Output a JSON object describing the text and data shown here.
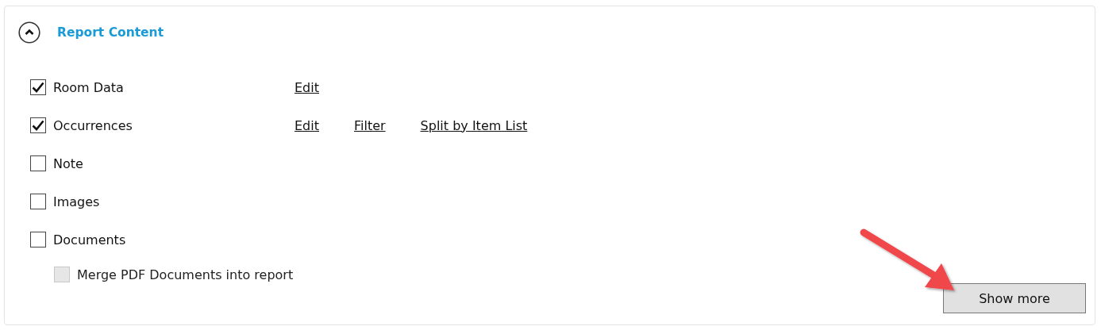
{
  "section": {
    "title": "Report Content",
    "expanded": true
  },
  "options": [
    {
      "label": "Room Data",
      "checked": true,
      "disabled": false,
      "links": [
        "Edit"
      ]
    },
    {
      "label": "Occurrences",
      "checked": true,
      "disabled": false,
      "links": [
        "Edit",
        "Filter",
        "Split by Item List"
      ]
    },
    {
      "label": "Note",
      "checked": false,
      "disabled": false
    },
    {
      "label": "Images",
      "checked": false,
      "disabled": false
    },
    {
      "label": "Documents",
      "checked": false,
      "disabled": false,
      "children": [
        {
          "label": "Merge PDF Documents into report",
          "checked": false,
          "disabled": true
        }
      ]
    }
  ],
  "buttons": [
    {
      "label": "Show more"
    }
  ]
}
